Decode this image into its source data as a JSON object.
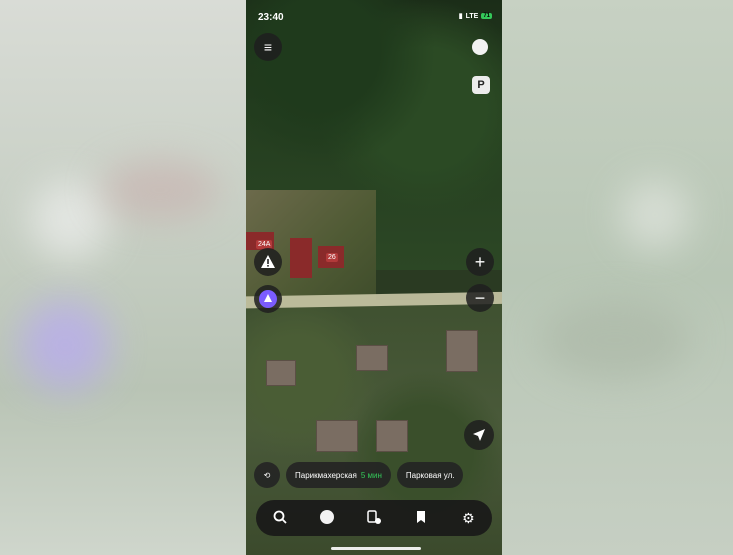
{
  "status_bar": {
    "time": "23:40",
    "network": "LTE",
    "battery": "71"
  },
  "map": {
    "house_numbers": [
      "24A",
      "26"
    ],
    "parking_label": "P"
  },
  "controls": {
    "zoom_in": "+",
    "zoom_out": "−"
  },
  "chips": [
    {
      "label": "Парикмахерская",
      "minutes": "5 мин"
    },
    {
      "label": "Парковая ул."
    }
  ],
  "bottom_bar": {
    "items": [
      "search-icon",
      "alice-icon",
      "routes-icon",
      "bookmarks-icon",
      "settings-icon"
    ]
  }
}
